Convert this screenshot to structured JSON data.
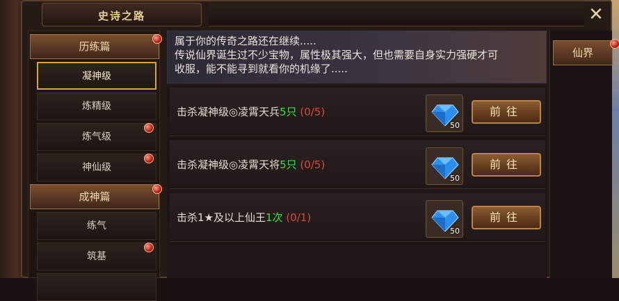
{
  "window": {
    "title": "史诗之路",
    "close_label": "✕"
  },
  "sidebar": {
    "sections": [
      {
        "label": "历练篇",
        "items": [
          {
            "label": "凝神级",
            "selected": true,
            "alert": false
          },
          {
            "label": "炼精级",
            "selected": false,
            "alert": false
          },
          {
            "label": "炼气级",
            "selected": false,
            "alert": true
          },
          {
            "label": "神仙级",
            "selected": false,
            "alert": true
          }
        ]
      },
      {
        "label": "成神篇",
        "items": [
          {
            "label": "练气",
            "selected": false,
            "alert": false
          },
          {
            "label": "筑基",
            "selected": false,
            "alert": true
          }
        ]
      }
    ]
  },
  "description": {
    "line1": "属于你的传奇之路还在继续.....",
    "line2": "传说仙界诞生过不少宝物，属性极其强大，但也需要自身实力强硬才可",
    "line3": "收服，能不能寻到就看你的机缘了....."
  },
  "tasks": [
    {
      "prefix": "击杀凝神级◎凌霄天兵",
      "count_text": "5只",
      "progress": "(0/5)",
      "reward_count": "50",
      "button_label": "前往"
    },
    {
      "prefix": "击杀凝神级◎凌霄天将",
      "count_text": "5只",
      "progress": "(0/5)",
      "reward_count": "50",
      "button_label": "前往"
    },
    {
      "prefix": "击杀1★及以上仙王",
      "count_text": "1次",
      "progress": "(0/1)",
      "reward_count": "50",
      "button_label": "前往"
    }
  ],
  "right_panel": {
    "tab_label": "仙界"
  },
  "colors": {
    "accent": "#d9a441",
    "success": "#3fe04a",
    "danger": "#d94a3b",
    "gem": "#2b8ff0"
  },
  "icons": {
    "close": "close-icon",
    "gem": "diamond-icon",
    "alert": "red-dot-icon"
  }
}
